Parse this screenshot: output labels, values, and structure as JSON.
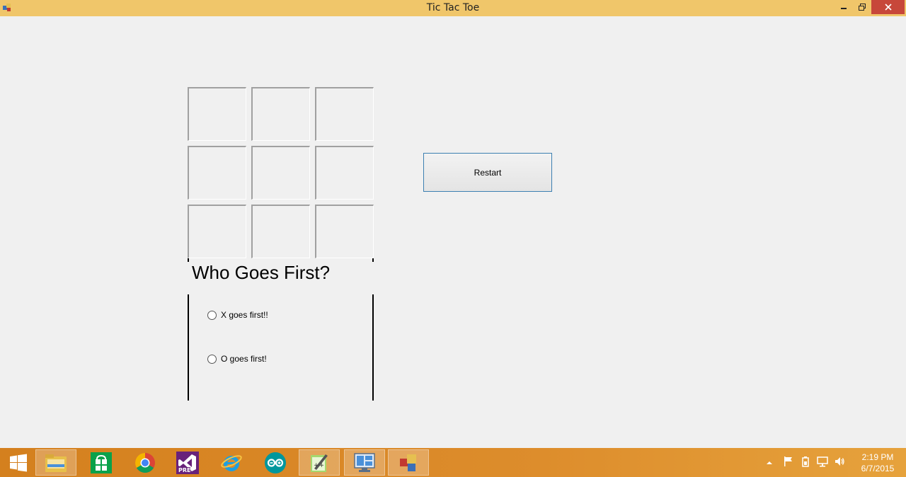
{
  "window": {
    "title": "Tic Tac Toe",
    "controls": {
      "minimize": "minimize-icon",
      "maximize": "restore-icon",
      "close": "close-icon"
    }
  },
  "board": {
    "cells": [
      "",
      "",
      "",
      "",
      "",
      "",
      "",
      "",
      ""
    ]
  },
  "restart_label": "Restart",
  "first_player": {
    "heading": "Who Goes First?",
    "options": [
      {
        "label": "X goes first!!",
        "selected": false
      },
      {
        "label": "O goes first!",
        "selected": false
      }
    ]
  },
  "taskbar": {
    "apps": [
      "start-icon",
      "file-explorer-icon",
      "store-icon",
      "chrome-icon",
      "visual-studio-icon",
      "internet-explorer-icon",
      "arduino-icon",
      "notepad-plus-plus-icon",
      "remote-desktop-icon",
      "tic-tac-toe-app-icon"
    ],
    "clock": {
      "time": "2:19 PM",
      "date": "6/7/2015"
    }
  },
  "colors": {
    "titlebar": "#f0c66a",
    "taskbar": "#d4801e",
    "close": "#c7473a",
    "restart_border": "#3c7fb1"
  }
}
